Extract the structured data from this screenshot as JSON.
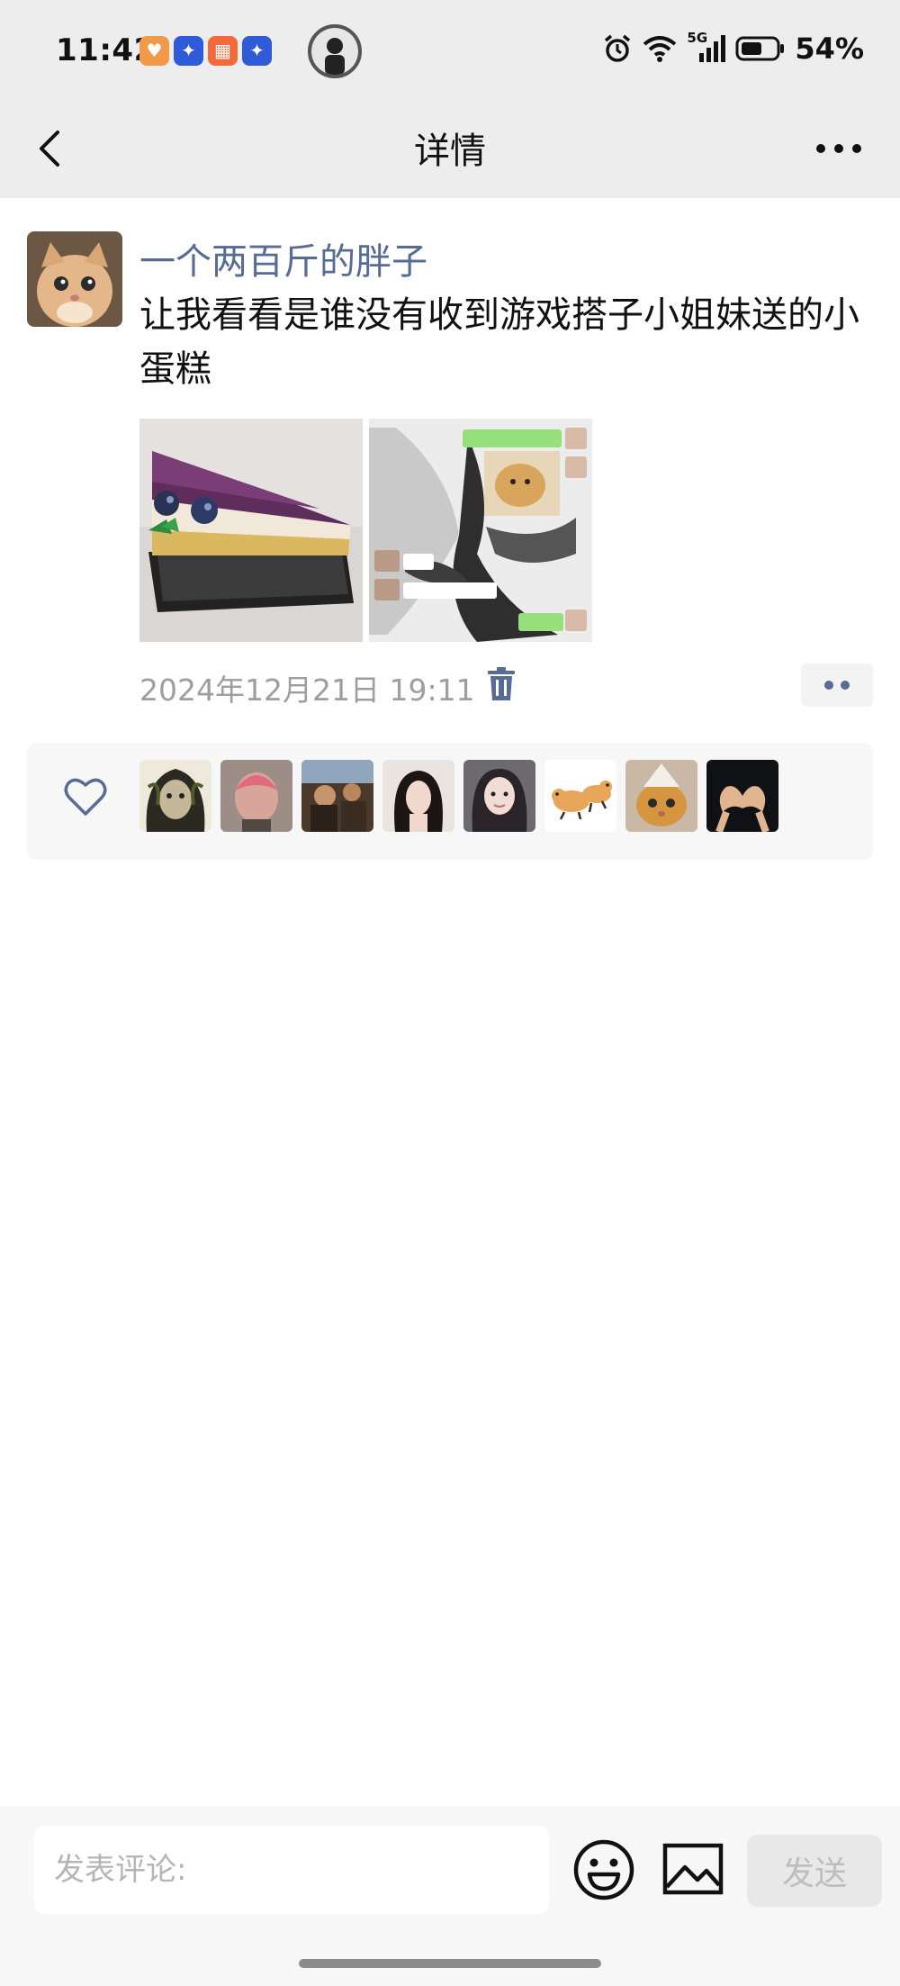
{
  "status_bar": {
    "time": "11:42",
    "battery": "54%",
    "network": "5G"
  },
  "nav": {
    "title": "详情"
  },
  "post": {
    "author": "一个两百斤的胖子",
    "text": "让我看看是谁没有收到游戏搭子小姐妹送的小蛋糕",
    "timestamp": "2024年12月21日 19:11"
  },
  "comment": {
    "placeholder": "发表评论:",
    "send_label": "发送"
  },
  "colors": {
    "author_link": "#576b95",
    "top_bar_bg": "#ededed"
  }
}
